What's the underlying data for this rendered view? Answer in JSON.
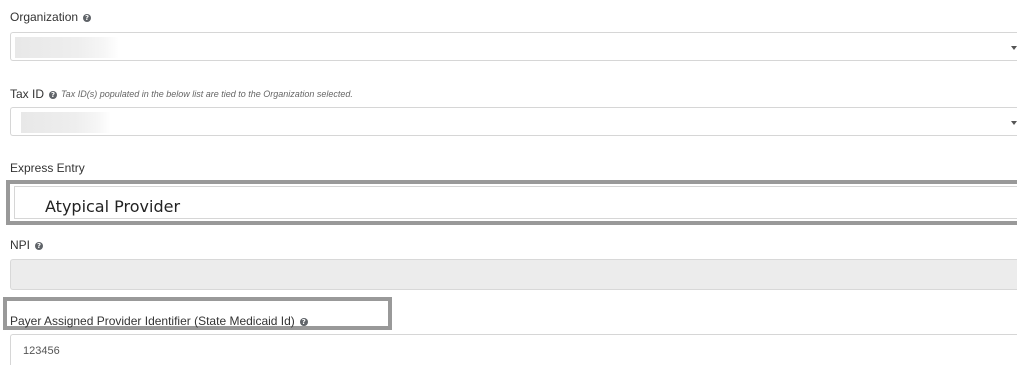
{
  "organization": {
    "label": "Organization",
    "help_icon": "?",
    "value": ""
  },
  "tax_id": {
    "label": "Tax ID",
    "help_icon": "?",
    "hint": "Tax ID(s) populated in the below list are tied to the Organization selected.",
    "value": ""
  },
  "express_entry": {
    "label": "Express Entry",
    "value": "Atypical Provider"
  },
  "npi": {
    "label": "NPI",
    "help_icon": "?",
    "value": ""
  },
  "payer_id": {
    "label": "Payer Assigned Provider Identifier (State Medicaid Id)",
    "help_icon": "?",
    "value": "123456"
  },
  "colors": {
    "highlight_border": "#999999",
    "disabled_field": "#ececec"
  }
}
